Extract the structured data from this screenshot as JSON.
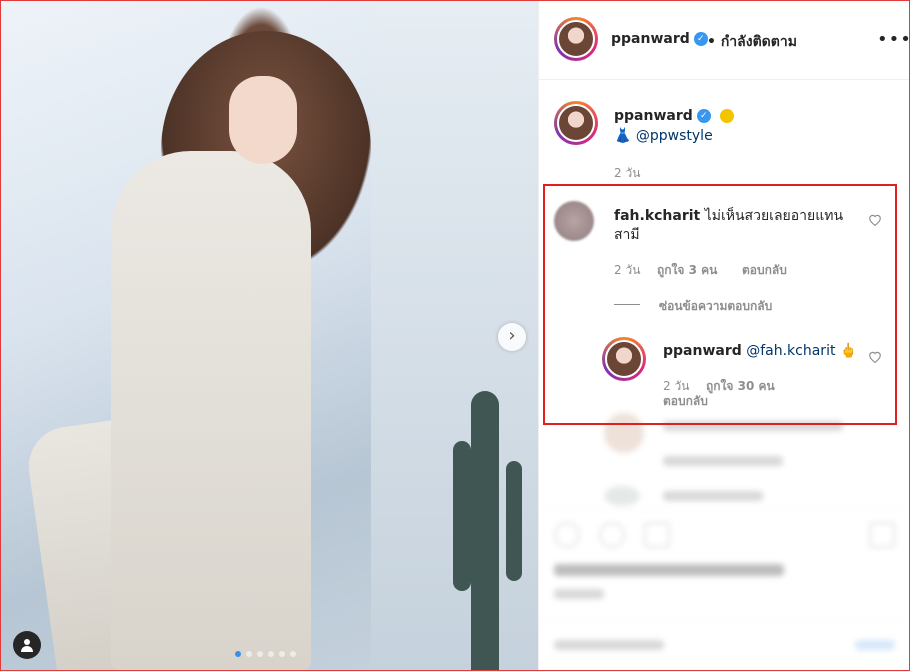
{
  "post": {
    "author": "ppanward",
    "follow_status": "• กำลังติดตาม",
    "more": "•••",
    "caption_mention": "@ppwstyle",
    "caption_time": "2 วัน",
    "image_dots": 6,
    "image_active_dot": 0
  },
  "comments": [
    {
      "user": "fah.kcharit",
      "text": "ไม่เห็นสวยเลยอายแทนสามี",
      "time": "2 วัน",
      "likes": "ถูกใจ 3 คน",
      "reply_label": "ตอบกลับ",
      "hide_replies": "ซ่อนข้อความตอบกลับ",
      "replies": [
        {
          "user": "ppanward",
          "mention": "@fah.kcharit",
          "emoji": "🖕",
          "time": "2 วัน",
          "likes": "ถูกใจ 30 คน",
          "reply_label": "ตอบกลับ"
        }
      ]
    }
  ],
  "icons": {
    "verified": "verified-badge-icon",
    "heart": "heart-icon",
    "next": "chevron-right-icon",
    "user_tag": "person-icon"
  },
  "colors": {
    "highlight_box": "#e02020",
    "verified": "#3897f0",
    "link": "#003569"
  }
}
